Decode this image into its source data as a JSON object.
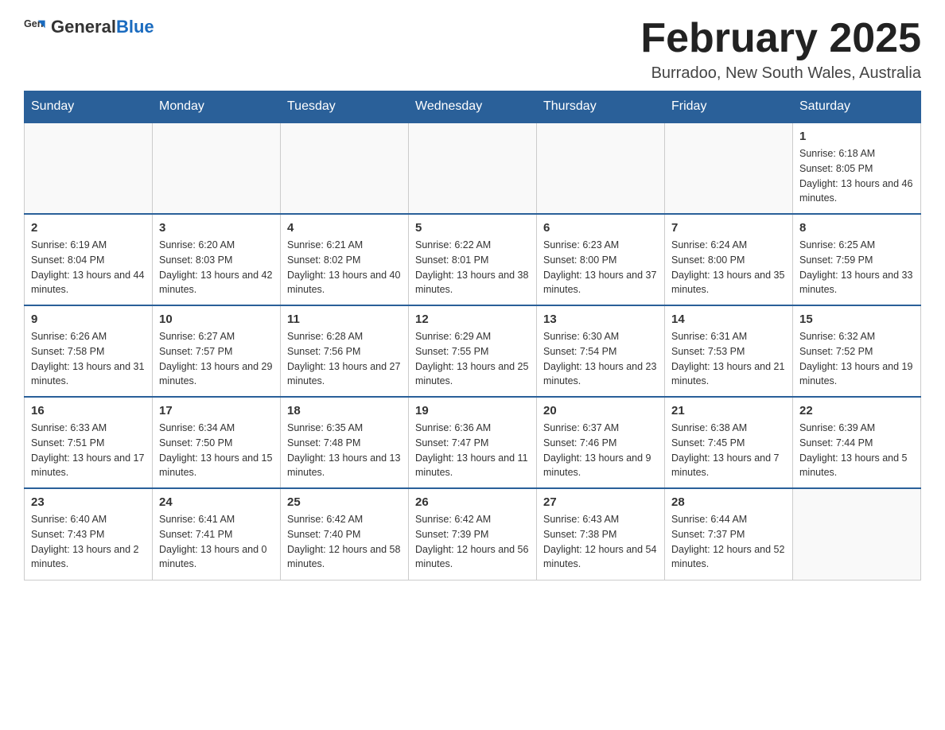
{
  "header": {
    "logo": {
      "text_general": "General",
      "text_blue": "Blue",
      "aria": "GeneralBlue logo"
    },
    "month_title": "February 2025",
    "location": "Burradoo, New South Wales, Australia"
  },
  "weekdays": [
    "Sunday",
    "Monday",
    "Tuesday",
    "Wednesday",
    "Thursday",
    "Friday",
    "Saturday"
  ],
  "weeks": [
    [
      {
        "day": "",
        "info": ""
      },
      {
        "day": "",
        "info": ""
      },
      {
        "day": "",
        "info": ""
      },
      {
        "day": "",
        "info": ""
      },
      {
        "day": "",
        "info": ""
      },
      {
        "day": "",
        "info": ""
      },
      {
        "day": "1",
        "info": "Sunrise: 6:18 AM\nSunset: 8:05 PM\nDaylight: 13 hours and 46 minutes."
      }
    ],
    [
      {
        "day": "2",
        "info": "Sunrise: 6:19 AM\nSunset: 8:04 PM\nDaylight: 13 hours and 44 minutes."
      },
      {
        "day": "3",
        "info": "Sunrise: 6:20 AM\nSunset: 8:03 PM\nDaylight: 13 hours and 42 minutes."
      },
      {
        "day": "4",
        "info": "Sunrise: 6:21 AM\nSunset: 8:02 PM\nDaylight: 13 hours and 40 minutes."
      },
      {
        "day": "5",
        "info": "Sunrise: 6:22 AM\nSunset: 8:01 PM\nDaylight: 13 hours and 38 minutes."
      },
      {
        "day": "6",
        "info": "Sunrise: 6:23 AM\nSunset: 8:00 PM\nDaylight: 13 hours and 37 minutes."
      },
      {
        "day": "7",
        "info": "Sunrise: 6:24 AM\nSunset: 8:00 PM\nDaylight: 13 hours and 35 minutes."
      },
      {
        "day": "8",
        "info": "Sunrise: 6:25 AM\nSunset: 7:59 PM\nDaylight: 13 hours and 33 minutes."
      }
    ],
    [
      {
        "day": "9",
        "info": "Sunrise: 6:26 AM\nSunset: 7:58 PM\nDaylight: 13 hours and 31 minutes."
      },
      {
        "day": "10",
        "info": "Sunrise: 6:27 AM\nSunset: 7:57 PM\nDaylight: 13 hours and 29 minutes."
      },
      {
        "day": "11",
        "info": "Sunrise: 6:28 AM\nSunset: 7:56 PM\nDaylight: 13 hours and 27 minutes."
      },
      {
        "day": "12",
        "info": "Sunrise: 6:29 AM\nSunset: 7:55 PM\nDaylight: 13 hours and 25 minutes."
      },
      {
        "day": "13",
        "info": "Sunrise: 6:30 AM\nSunset: 7:54 PM\nDaylight: 13 hours and 23 minutes."
      },
      {
        "day": "14",
        "info": "Sunrise: 6:31 AM\nSunset: 7:53 PM\nDaylight: 13 hours and 21 minutes."
      },
      {
        "day": "15",
        "info": "Sunrise: 6:32 AM\nSunset: 7:52 PM\nDaylight: 13 hours and 19 minutes."
      }
    ],
    [
      {
        "day": "16",
        "info": "Sunrise: 6:33 AM\nSunset: 7:51 PM\nDaylight: 13 hours and 17 minutes."
      },
      {
        "day": "17",
        "info": "Sunrise: 6:34 AM\nSunset: 7:50 PM\nDaylight: 13 hours and 15 minutes."
      },
      {
        "day": "18",
        "info": "Sunrise: 6:35 AM\nSunset: 7:48 PM\nDaylight: 13 hours and 13 minutes."
      },
      {
        "day": "19",
        "info": "Sunrise: 6:36 AM\nSunset: 7:47 PM\nDaylight: 13 hours and 11 minutes."
      },
      {
        "day": "20",
        "info": "Sunrise: 6:37 AM\nSunset: 7:46 PM\nDaylight: 13 hours and 9 minutes."
      },
      {
        "day": "21",
        "info": "Sunrise: 6:38 AM\nSunset: 7:45 PM\nDaylight: 13 hours and 7 minutes."
      },
      {
        "day": "22",
        "info": "Sunrise: 6:39 AM\nSunset: 7:44 PM\nDaylight: 13 hours and 5 minutes."
      }
    ],
    [
      {
        "day": "23",
        "info": "Sunrise: 6:40 AM\nSunset: 7:43 PM\nDaylight: 13 hours and 2 minutes."
      },
      {
        "day": "24",
        "info": "Sunrise: 6:41 AM\nSunset: 7:41 PM\nDaylight: 13 hours and 0 minutes."
      },
      {
        "day": "25",
        "info": "Sunrise: 6:42 AM\nSunset: 7:40 PM\nDaylight: 12 hours and 58 minutes."
      },
      {
        "day": "26",
        "info": "Sunrise: 6:42 AM\nSunset: 7:39 PM\nDaylight: 12 hours and 56 minutes."
      },
      {
        "day": "27",
        "info": "Sunrise: 6:43 AM\nSunset: 7:38 PM\nDaylight: 12 hours and 54 minutes."
      },
      {
        "day": "28",
        "info": "Sunrise: 6:44 AM\nSunset: 7:37 PM\nDaylight: 12 hours and 52 minutes."
      },
      {
        "day": "",
        "info": ""
      }
    ]
  ]
}
